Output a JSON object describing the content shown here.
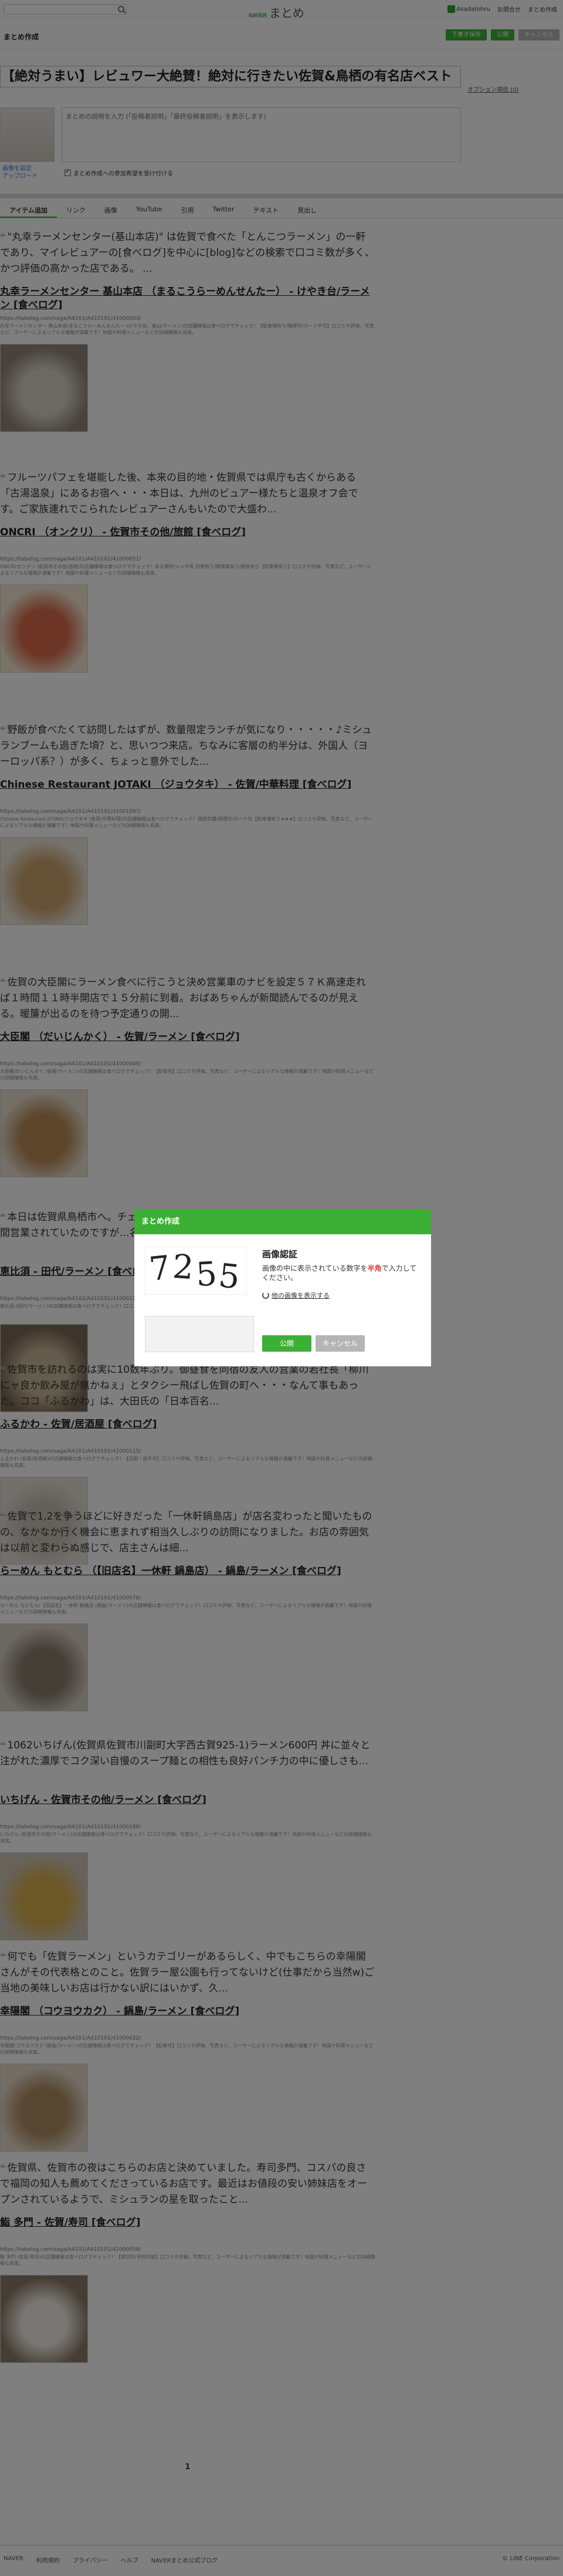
{
  "topbar": {
    "search_placeholder": "",
    "brand_prefix": "NAVER",
    "brand_name": "まとめ",
    "user_name": "Asadatohru",
    "links": [
      "お問合せ",
      "まとめ作成"
    ]
  },
  "editor": {
    "title": "まとめ作成",
    "buttons": {
      "save_draft": "下書き保存",
      "publish": "公開",
      "cancel": "キャンセル"
    },
    "matome_title": "【絶対うまい】レビュワー大絶賛！絶対に行きたい佐賀&鳥栖の有名店ベスト",
    "option_link": "オプション項目 (0)",
    "thumb_label": "画像を設定\nアップロード",
    "desc_placeholder": "まとめの説明を入力 (「投稿者説明」「最終投稿者説明」を表示します)",
    "agree_label": "まとめ作成への参加希望を受け付ける",
    "agree_checked": true
  },
  "tabs": [
    "アイテム追加",
    "リンク",
    "画像",
    "YouTube",
    "引用",
    "Twitter",
    "テキスト",
    "見出し"
  ],
  "items": [
    {
      "quote": "\"丸幸ラーメンセンター(基山本店)\" は佐賀で食べた「とんこつラーメン」の一軒であり、マイレビュアーの[食べログ]を中心に[blog]などの検索で口コミ数が多く、かつ評価の高かった店である。 ...",
      "title": "丸幸ラーメンセンター 基山本店 （まるこうらーめんせんたー） - けやき台/ラーメン [食べログ]",
      "url": "https://tabelog.com/saga/A4101/A410101/41000003/",
      "desc": "丸幸ラーメンセンター 基山本店/まるこうらーめんせんたー (けやき台、基山/ラーメン)の店舗情報は食べログでチェック！【駐車場有り/喫煙可/カード不可】口コミや評価、写真など、ユーザーによるリアルな情報が満載です！地図や料理メニューなどの詳細情報も充実。"
    },
    {
      "quote": "フルーツパフェを堪能した後、本来の目的地・佐賀県では県庁も古くからある「古湯温泉」にあるお宿へ・・・本日は、九州のビュアー様たちと温泉オフ会です。ご家族連れでこられたレビュアーさんもいたので大盛わ...",
      "title": "ONCRI （オンクリ） - 佐賀市その他/旅館 [食べログ]",
      "url": "https://tabelog.com/saga/A4101/A410101/41000651/",
      "desc": "ONCRI/オンクリ (佐賀市その他/旅館)の店舗情報は食べログでチェック！ある場所/シャギ有 別室有り/喫煙席あり/個室あり【駐車場有り】口コミや評価、写真など、ユーザーによるリアルな情報が満載です！地図や料理メニューなどの詳細情報も充実。"
    },
    {
      "quote": "野飯が食べたくて訪問したはずが、数量限定ランチが気になり・・・・・♪ミシュランブームも過ぎた頃？と、思いつつ来店。ちなみに客層の約半分は、外国人（ヨーロッパ系？）が多く、ちょっと意外でした...",
      "title": "Chinese Restaurant JOTAKI （ジョウタキ） - 佐賀/中華料理 [食べログ]",
      "url": "https://tabelog.com/saga/A4101/A410101/41001097/",
      "desc": "Chinese Restaurant JOTAKI/ジョウタキ (佐賀/中華料理)の店舗情報は食べログでチェック！個室完備/喫煙可/カード可【駐車場有り★★★】口コミや評価、写真など、ユーザーによるリアルな情報が満載です！地図や料理メニューなどの詳細情報も充実。"
    },
    {
      "quote": "佐賀の大臣閣にラーメン食べに行こうと決め営業車のナビを設定５７Ｋ高速走れば１時間１１時半開店で１５分前に到着。おばあちゃんが新聞読んでるのが見える。暖簾が出るのを待つ予定通りの開...",
      "title": "大臣閣 （だいじんかく） - 佐賀/ラーメン [食べログ]",
      "url": "https://tabelog.com/saga/A4101/A410101/41000040/",
      "desc": "大臣閣/だいじんかく (佐賀/ラーメン)の店舗情報は食べログでチェック！【駐車可】口コミや評価、写真など、ユーザーによるリアルな情報が満載です！地図や料理メニューなどの詳細情報も充実。"
    },
    {
      "quote": "本日は佐賀県鳥栖市へ。チェーン店しか聞いていない…あまり期待せず。おお、週間営業されていたのですが…名店の看板もなかった。よし、こち...",
      "title": "恵比須 - 田代/ラーメン [食べログ]",
      "url": "https://tabelog.com/saga/A4102/A410201/41000111/",
      "desc": "恵比須 (田代/ラーメン)の店舗情報は食べログでチェック！口コミや評価、写真など、ユーザーによるリアルな情報が満載です！地図や料理メニューなどの詳細情報も充実。"
    },
    {
      "quote": "佐賀市を訪れるのは実に10数年ぶり。御昼食を同宿の友人の営業の若社長「柳川にャ良か飲み屋が無かねぇ」とタクシー飛ばし佐賀の町へ・・・なんて事もあった。ココ「ふるかわ」は、大田氏の「日本百名...",
      "title": "ふるかわ - 佐賀/居酒屋 [食べログ]",
      "url": "https://tabelog.com/saga/A4101/A410101/41000115/",
      "desc": "ふるかわ (佐賀/居酒屋)の店舗情報は食べログでチェック！【日祝・昼不可】口コミや評価、写真など、ユーザーによるリアルな情報が満載です！地図や料理メニューなどの詳細情報も充実。"
    },
    {
      "quote": "佐賀で1,2を争うほどに好きだった「一休軒鍋島店」が店名変わったと聞いたものの、なかなか行く機会に恵まれず相当久しぶりの訪問になりました。お店の雰囲気は以前と変わらぬ感じで、店主さんは細...",
      "title": "らーめん もとむら （【旧店名】一休軒 鍋島店） - 鍋島/ラーメン [食べログ]",
      "url": "https://tabelog.com/saga/A4101/A410101/41000076/",
      "desc": "らーめん もとむら/【旧店名】一休軒 鍋島店 (鍋島/ラーメン)の店舗情報は食べログでチェック！口コミや評価、写真など、ユーザーによるリアルな情報が満載です！地図や料理メニューなどの詳細情報も充実。"
    },
    {
      "quote": "1062いちげん(佐賀県佐賀市川副町大字西古賀925-1)ラーメン600円 丼に並々と注がれた濃厚でコク深い自慢のスープ麺との相性も良好パンチ力の中に優しさも...",
      "title": "いちげん - 佐賀市その他/ラーメン [食べログ]",
      "url": "https://tabelog.com/saga/A4101/A410101/41000186/",
      "desc": "いちげん (佐賀市その他/ラーメン)の店舗情報は食べログでチェック！口コミや評価、写真など、ユーザーによるリアルな情報が満載です！地図や料理メニューなどの詳細情報も充実。"
    },
    {
      "quote": "何でも「佐賀ラーメン」というカテゴリーがあるらしく、中でもこちらの幸陽閣さんがその代表格とのこと。佐賀ラー屋公園も行ってないけど(仕事だから当然w)ご当地の美味しいお店は行かない訳にはいかず、久...",
      "title": "幸陽閣 （コウヨウカク） - 鍋島/ラーメン [食べログ]",
      "url": "https://tabelog.com/saga/A4101/A410101/41000022/",
      "desc": "幸陽閣/コウヨウカク (鍋島/ラーメン)の店舗情報は食べログでチェック！【駐車可】口コミや評価、写真など、ユーザーによるリアルな情報が満載です！地図や料理メニューなどの詳細情報も充実。"
    },
    {
      "quote": "佐賀県、佐賀市の夜はこちらのお店と決めていました。寿司多門、コスパの良さで福岡の知人も薦めてくださっているお店です。最近はお値段の安い姉妹店をオープンされているようで、ミシュランの星を取ったこと...",
      "title": "鮨 多門 - 佐賀/寿司 [食べログ]",
      "url": "https://tabelog.com/saga/A4101/A410101/41000058/",
      "desc": "鮨 多門 (佐賀/寿司)の店舗情報は食べログでチェック！【貸切可/予約可能】口コミや評価、写真など、ユーザーによるリアルな情報が満載です！地図や料理メニューなどの詳細情報も充実。"
    }
  ],
  "pager": "1",
  "footer": {
    "links": [
      "NAVER",
      "利用規約",
      "プライバシー",
      "ヘルプ",
      "NAVERまとめ公式ブログ"
    ],
    "copyright": "© LINE Corporation"
  },
  "modal": {
    "header": "まとめ作成",
    "captcha_digits": [
      "7",
      "2",
      "5",
      "5"
    ],
    "title": "画像認証",
    "instruction_pre": "画像の中に表示されている数字を",
    "instruction_red": "半角",
    "instruction_post": "で入力してください。",
    "refresh_label": "他の画像を表示する",
    "answer_value": "",
    "submit_label": "公開",
    "cancel_label": "キャンセル"
  }
}
